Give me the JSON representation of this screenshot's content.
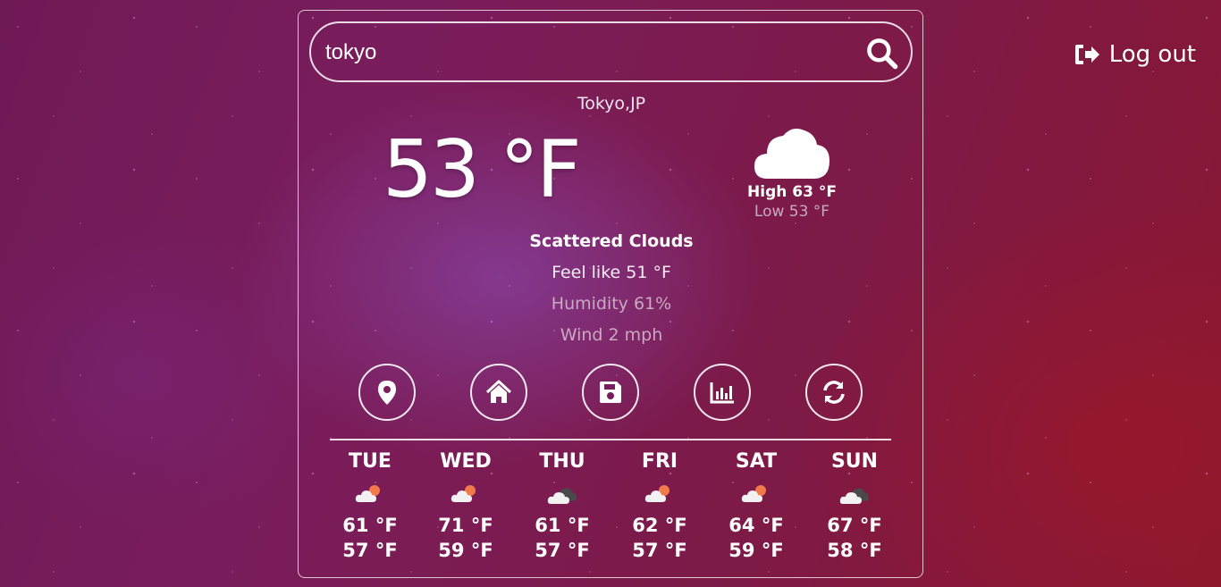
{
  "header": {
    "logout_label": "Log out"
  },
  "search": {
    "value": "tokyo"
  },
  "current": {
    "location": "Tokyo,JP",
    "temperature": "53 °F",
    "high": "High 63 °F",
    "low": "Low 53 °F",
    "description": "Scattered Clouds",
    "feels_like": "Feel like 51 °F",
    "humidity": "Humidity 61%",
    "wind": "Wind 2 mph",
    "icon": "cloud-icon"
  },
  "actions": [
    {
      "name": "location-button",
      "icon": "map-marker-icon"
    },
    {
      "name": "home-button",
      "icon": "home-icon"
    },
    {
      "name": "save-button",
      "icon": "save-icon"
    },
    {
      "name": "chart-button",
      "icon": "bar-chart-icon"
    },
    {
      "name": "refresh-button",
      "icon": "refresh-icon"
    }
  ],
  "forecast": [
    {
      "day": "TUE",
      "high": "61 °F",
      "low": "57 °F",
      "icon": "partly-cloudy-icon"
    },
    {
      "day": "WED",
      "high": "71 °F",
      "low": "59 °F",
      "icon": "partly-cloudy-icon"
    },
    {
      "day": "THU",
      "high": "61 °F",
      "low": "57 °F",
      "icon": "broken-clouds-icon"
    },
    {
      "day": "FRI",
      "high": "62 °F",
      "low": "57 °F",
      "icon": "partly-cloudy-icon"
    },
    {
      "day": "SAT",
      "high": "64 °F",
      "low": "59 °F",
      "icon": "partly-cloudy-icon"
    },
    {
      "day": "SUN",
      "high": "67 °F",
      "low": "58 °F",
      "icon": "broken-clouds-icon"
    }
  ]
}
